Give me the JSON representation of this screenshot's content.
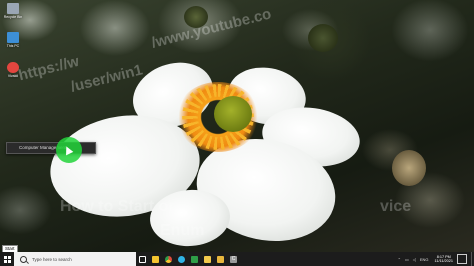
{
  "watermarks": {
    "line1": "/www.youtube.co",
    "line2": "https://w",
    "line3": "/user/win1",
    "line4": "How to Start or",
    "line5": "Enum",
    "line6": "vice"
  },
  "desktop_icons": [
    {
      "label": "Recycle Bin",
      "icon": "recycle-bin-icon",
      "color": "#9aa6b4"
    },
    {
      "label": "This PC",
      "icon": "computer-icon",
      "color": "#3d8fd6"
    },
    {
      "label": "Vivaldi",
      "icon": "vivaldi-icon",
      "color": "#e3463f"
    }
  ],
  "context_menu": {
    "item": "Computer Management"
  },
  "tooltip": {
    "text": "Start"
  },
  "taskbar": {
    "search_placeholder": "Type here to search",
    "pinned": [
      {
        "name": "task-view-icon",
        "color": "#ffffff"
      },
      {
        "name": "file-explorer-icon",
        "color": "#f4c430"
      },
      {
        "name": "chrome-icon",
        "color": "#e24a3b"
      },
      {
        "name": "edge-icon",
        "color": "#2fb4e6"
      },
      {
        "name": "green-app-icon",
        "color": "#2e9e48"
      },
      {
        "name": "paint-icon",
        "color": "#f2c94c"
      },
      {
        "name": "folder-icon",
        "color": "#e8b63d"
      },
      {
        "name": "c-app-icon",
        "color": "#9a9a9a"
      }
    ],
    "tray": {
      "lang": "ENG",
      "time": "8:17 PM",
      "date": "11/11/2021"
    }
  }
}
